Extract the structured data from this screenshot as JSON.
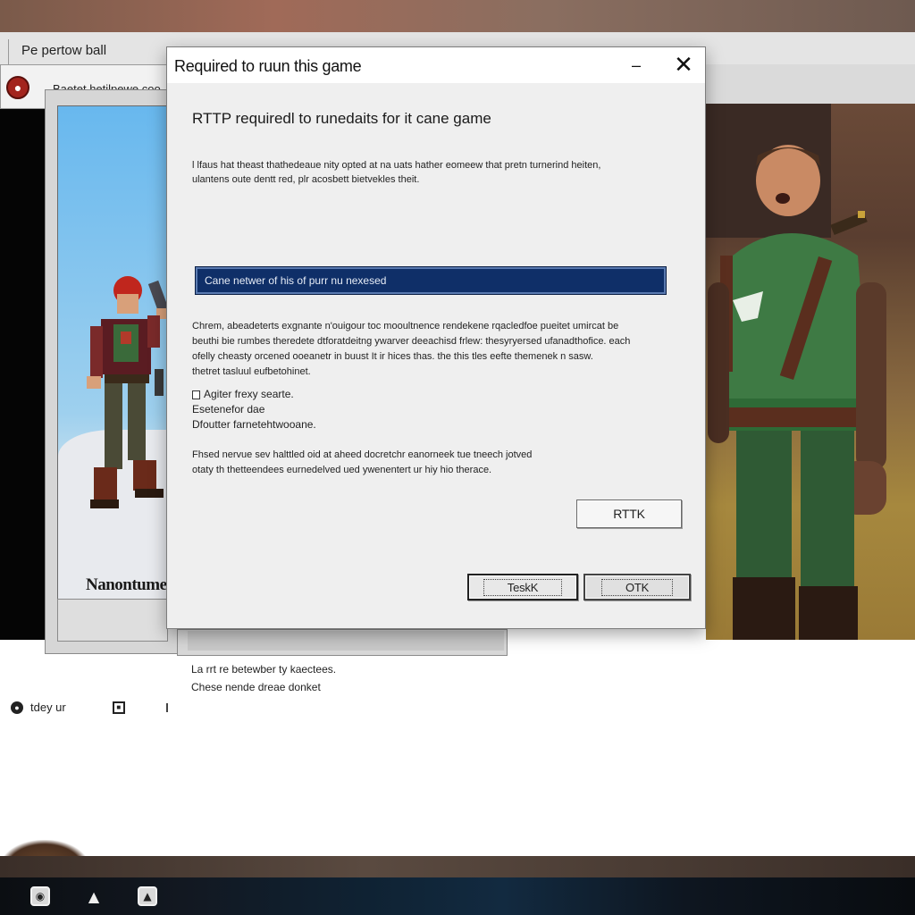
{
  "back_window": {
    "title": "Pe pertow ball",
    "tab_label": "Baetet hetilpewe coo"
  },
  "game_panel": {
    "caption": "Nanontume"
  },
  "dialog": {
    "title": "Required to ruun this game",
    "minimize_glyph": "–",
    "close_glyph": "✕",
    "heading": "RTTP  requiredl to runedaits for it cane game",
    "intro_lines": [
      "l lfaus hat theast thathedeaue nity opted at na uats hather eomeew that pretn turnerind heiten,",
      "ulantens oute dentt red,  plr acosbett bietvekles theit."
    ],
    "input_value": "Cane netwer of his of purr nu nexesed",
    "body_lines": [
      "Chrem,  abeadeterts exgnante n'ouigour toc mooultnence rendekene rqacledfoe pueitet umircat be",
      "beuthi bie rumbes theredete dtforatdeitng ywarver deeachisd frlew: thesyryersed ufanadthofice. each",
      "ofelly  cheasty orcened ooeanetr in buust It ir hices thas. the this tles eefte themenek n sasw.",
      "thetret tasluul eufbetohinet."
    ],
    "options": [
      "Agiter frexy searte.",
      "Esetenefor dae",
      "Dfoutter farnetehtwooane."
    ],
    "note_lines": [
      "Fhsed nervue sev halttled oid at aheed docretchr eanorneek tue tneech jotved",
      "otaty th thetteendees eurnedelved ued ywenentert ur hiy hio therace."
    ],
    "buttons": {
      "rtk": "RTTK",
      "ok": "TeskK",
      "cancel": "OTK"
    }
  },
  "below_text": {
    "line1": "La rrt re betewber ty kaectees.",
    "line2": "Chese  nende dreae  donket"
  },
  "status_bar": {
    "label": "tdey ur"
  },
  "taskbar": {
    "icons": [
      "app-icon-1",
      "app-icon-2",
      "app-icon-3"
    ]
  },
  "colors": {
    "input_bg": "#0f2f68",
    "accent_red": "#a3241d",
    "sky": "#68b8ee",
    "dialog_bg": "#efefef"
  }
}
